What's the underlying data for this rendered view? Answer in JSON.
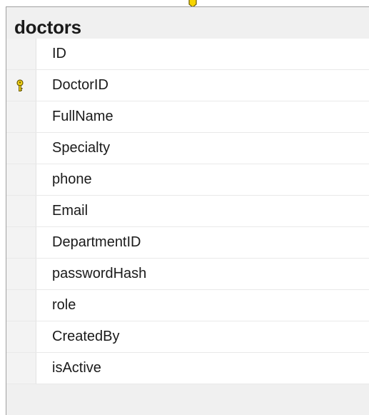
{
  "table": {
    "title": "doctors",
    "columns": [
      {
        "name": "ID",
        "primary_key": false
      },
      {
        "name": "DoctorID",
        "primary_key": true
      },
      {
        "name": "FullName",
        "primary_key": false
      },
      {
        "name": "Specialty",
        "primary_key": false
      },
      {
        "name": "phone",
        "primary_key": false
      },
      {
        "name": "Email",
        "primary_key": false
      },
      {
        "name": "DepartmentID",
        "primary_key": false
      },
      {
        "name": "passwordHash",
        "primary_key": false
      },
      {
        "name": "role",
        "primary_key": false
      },
      {
        "name": "CreatedBy",
        "primary_key": false
      },
      {
        "name": "isActive",
        "primary_key": false
      }
    ]
  },
  "icons": {
    "primary_key": "key-icon",
    "relationship": "relationship-key-icon"
  },
  "colors": {
    "key_gold": "#e8c400",
    "key_outline": "#7a6200",
    "header_bg": "#f0f0f0",
    "grid_bg": "#ffffff"
  }
}
